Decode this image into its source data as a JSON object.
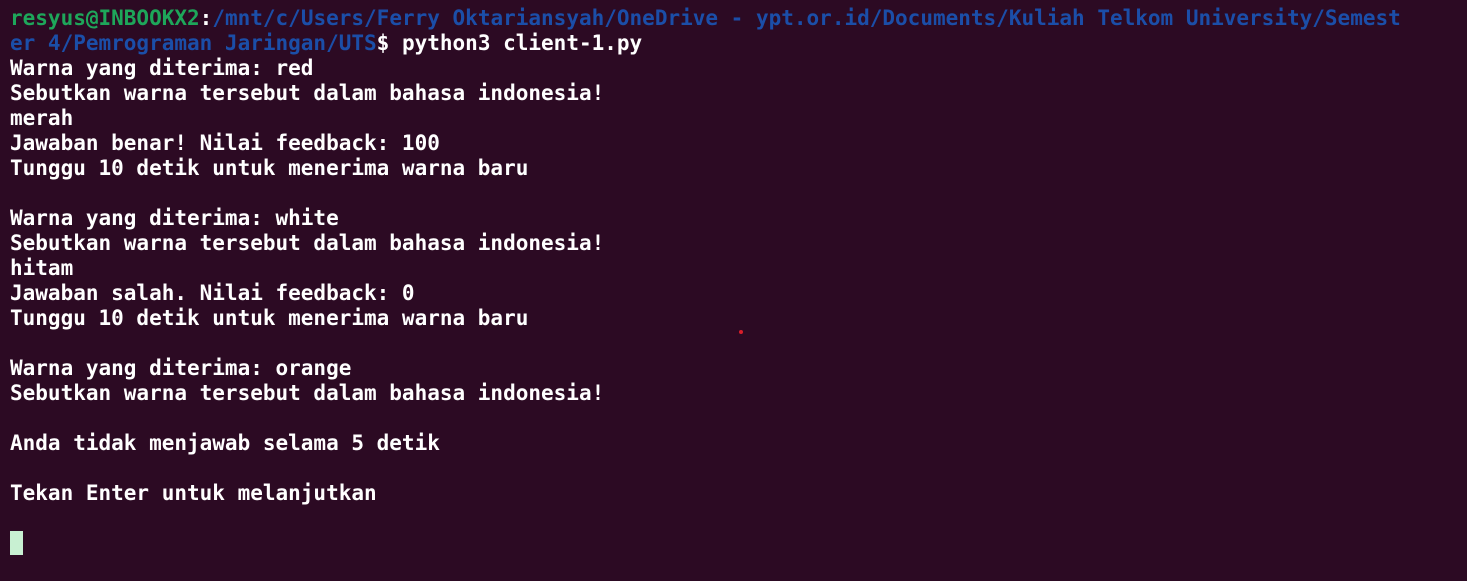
{
  "prompt": {
    "user_host": "resyus@INBOOKX2",
    "colon": ":",
    "path_line1": "/mnt/c/Users/Ferry Oktariansyah/OneDrive - ypt.or.id/Documents/Kuliah Telkom University/Semest",
    "path_line2": "er 4/Pemrograman Jaringan/UTS",
    "dollar": "$",
    "command": " python3 client-1.py"
  },
  "output": [
    "Warna yang diterima: red",
    "Sebutkan warna tersebut dalam bahasa indonesia!",
    "merah",
    "Jawaban benar! Nilai feedback: 100",
    "Tunggu 10 detik untuk menerima warna baru",
    "",
    "Warna yang diterima: white",
    "Sebutkan warna tersebut dalam bahasa indonesia!",
    "hitam",
    "Jawaban salah. Nilai feedback: 0",
    "Tunggu 10 detik untuk menerima warna baru",
    "",
    "Warna yang diterima: orange",
    "Sebutkan warna tersebut dalam bahasa indonesia!",
    "",
    "Anda tidak menjawab selama 5 detik",
    "",
    "Tekan Enter untuk melanjutkan",
    ""
  ],
  "colors": {
    "background": "#2c0a23",
    "user_host": "#1ea65a",
    "path": "#1b4ea8",
    "text": "#ffffff",
    "cursor": "#c8f0d2"
  }
}
